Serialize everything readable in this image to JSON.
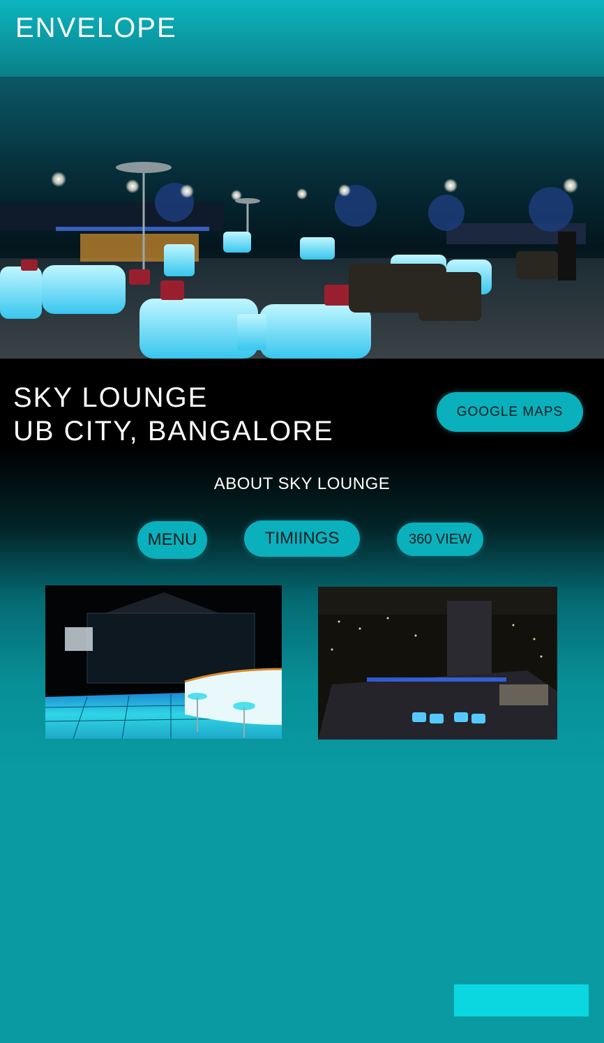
{
  "header": {
    "brand": "ENVELOPE"
  },
  "hero": {
    "image": "rooftop-lounge-night-photo"
  },
  "venue": {
    "name": "SKY LOUNGE",
    "location": "UB CITY, BANGALORE"
  },
  "actions": {
    "google_maps": "GOOGLE MAPS"
  },
  "about": {
    "label": "ABOUT SKY LOUNGE"
  },
  "tabs": [
    {
      "label": "MENU"
    },
    {
      "label": "TIMIINGS"
    },
    {
      "label": "360 VIEW"
    }
  ],
  "gallery": [
    {
      "image": "glowing-bar-dance-floor-photo"
    },
    {
      "image": "aerial-rooftop-city-night-photo"
    }
  ],
  "colors": {
    "accent": "#0ab0bb",
    "header": "#0b9ea8",
    "cta": "#0ad7e0"
  }
}
